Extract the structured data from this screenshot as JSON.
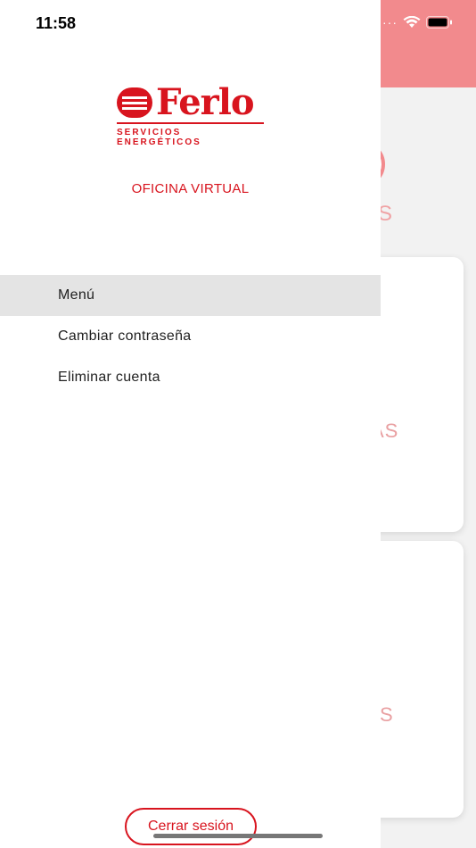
{
  "status_bar": {
    "time": "11:58"
  },
  "brand": {
    "name": "Ferlo",
    "tagline": "SERVICIOS ENERGÉTICOS",
    "color": "#d8141e"
  },
  "drawer": {
    "title": "OFICINA VIRTUAL",
    "items": [
      {
        "label": "Menú",
        "active": true
      },
      {
        "label": "Cambiar contraseña",
        "active": false
      },
      {
        "label": "Eliminar cuenta",
        "active": false
      }
    ],
    "logout_label": "Cerrar sesión"
  },
  "background": {
    "header_color": "#f28a8d",
    "circle_fragment": "S",
    "card1_fragment": "AS",
    "card2_fragment": "S"
  }
}
